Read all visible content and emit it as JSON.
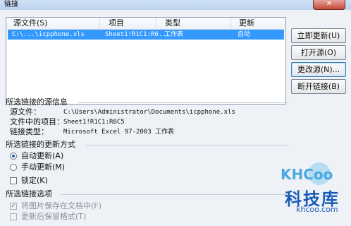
{
  "window": {
    "title": "链接"
  },
  "list": {
    "headers": [
      "源文件(S)",
      "项目",
      "类型",
      "更新"
    ],
    "rows": [
      {
        "source": "C:\\...\\icpphone.xls",
        "item": "Sheet1!R1C1:R6...",
        "type": "工作表",
        "update": "自动"
      }
    ]
  },
  "buttons": {
    "update_now": "立即更新(U)",
    "open_source": "打开源(O)",
    "change_source": "更改源(N)...",
    "break_link": "断开链接(B)"
  },
  "source_info": {
    "heading": "所选链接的源信息",
    "source_file_label": "源文件：",
    "source_file": "C:\\Users\\Administrator\\Documents\\icpphone.xls",
    "item_label": "文件中的项目：",
    "item": "Sheet1!R1C1:R6C5",
    "type_label": "链接类型：",
    "type": "Microsoft Excel 97-2003 工作表"
  },
  "update_mode": {
    "heading": "所选链接的更新方式",
    "auto": "自动更新(A)",
    "manual": "手动更新(M)",
    "selected": "auto"
  },
  "lock": {
    "label": "锁定(K)",
    "checked": false
  },
  "link_options": {
    "heading": "所选链接选项",
    "save_picture": "将图片保存在文档中(F)",
    "save_picture_checked": true,
    "keep_format": "更新后保留格式(T)",
    "keep_format_checked": false
  },
  "watermark": {
    "logo": "KHCoo",
    "name": "科技库",
    "site": "khcoo.com"
  }
}
